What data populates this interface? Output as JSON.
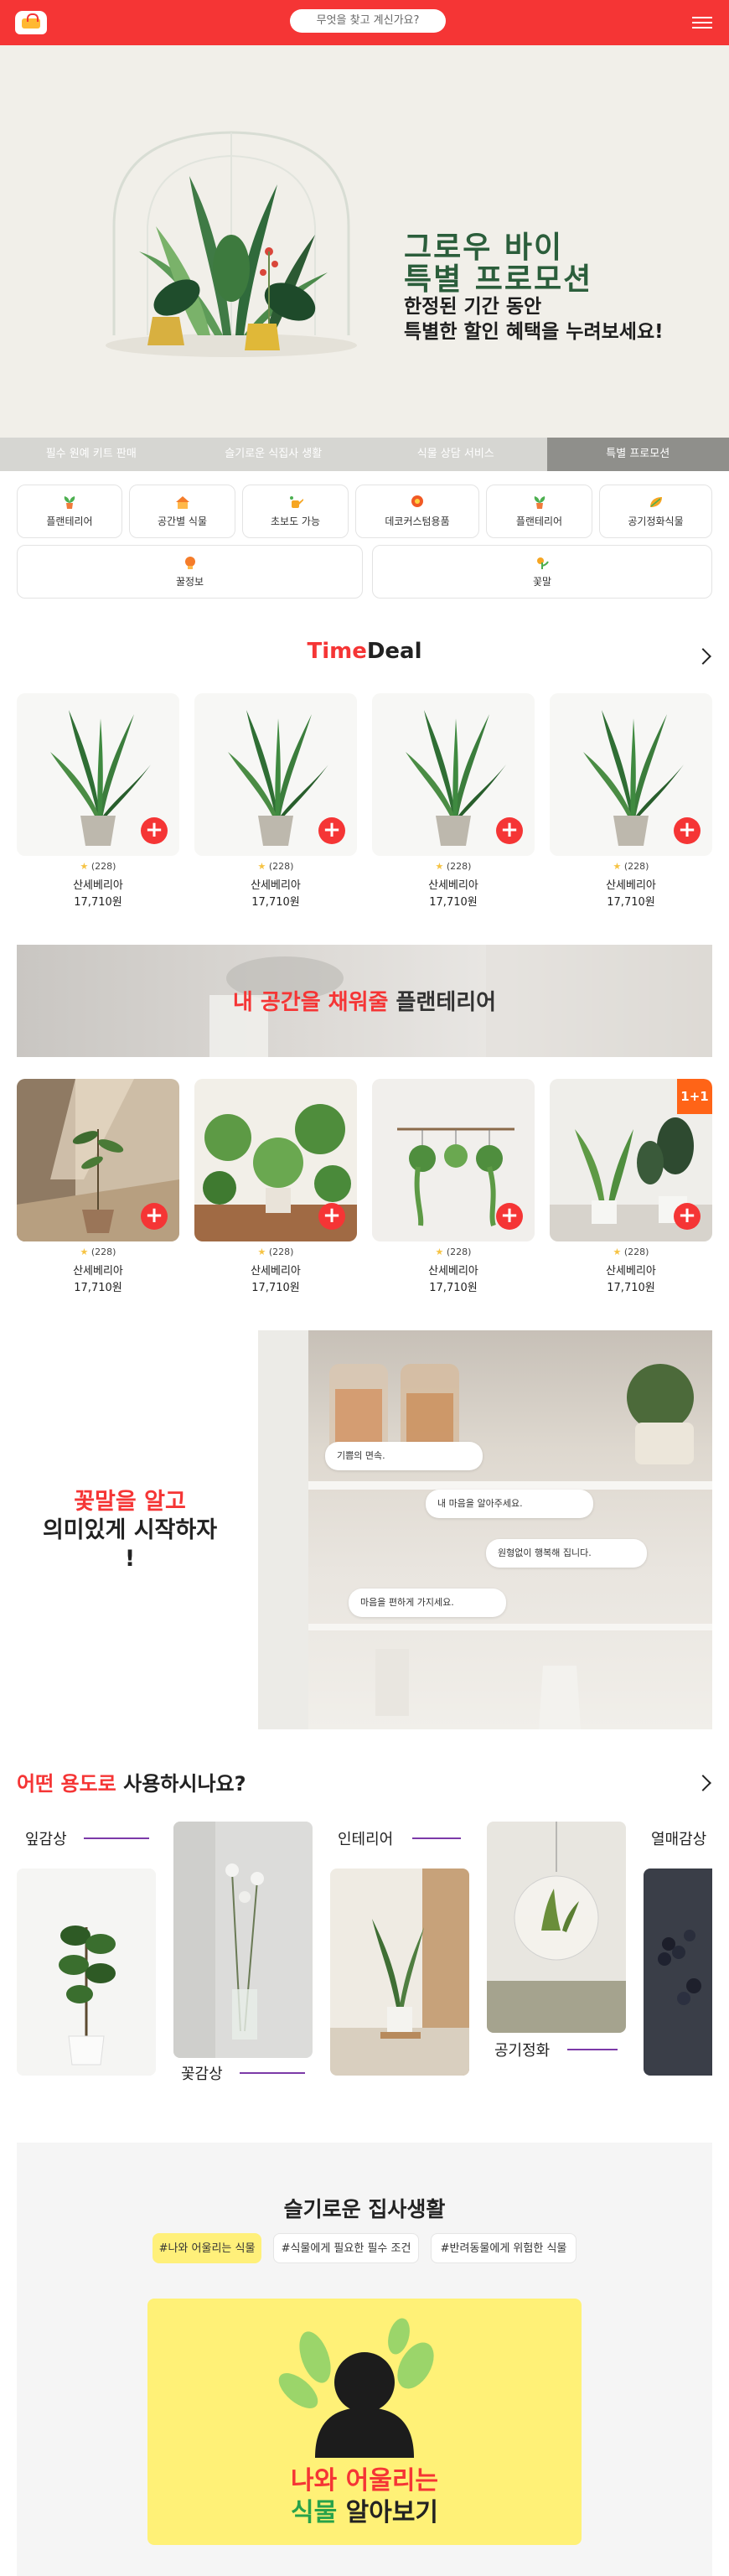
{
  "header": {
    "search_placeholder": "무엇을 찾고 계신가요?"
  },
  "hero": {
    "title_line1": "그로우 바이",
    "title_line2": "특별 프로모션",
    "sub_line1": "한정된 기간 동안",
    "sub_line2": "특별한 할인 혜택을 누려보세요!"
  },
  "tabs": [
    {
      "label": "필수 원예 키트 판매"
    },
    {
      "label": "슬기로운 식집사 생활"
    },
    {
      "label": "식물 상담 서비스"
    },
    {
      "label": "특별 프로모션"
    }
  ],
  "categories": [
    {
      "label": "플랜테리어",
      "icon": "plant-icon"
    },
    {
      "label": "공간별 식물",
      "icon": "house-icon"
    },
    {
      "label": "초보도 가능",
      "icon": "watering-can-icon"
    },
    {
      "label": "데코커스텀용품",
      "icon": "pot-icon"
    },
    {
      "label": "플랜테리어",
      "icon": "plant-icon"
    },
    {
      "label": "공기정화식물",
      "icon": "leaf-icon"
    },
    {
      "label": "꿀정보",
      "icon": "lightbulb-icon"
    },
    {
      "label": "꽃말",
      "icon": "flower-icon"
    }
  ],
  "timedeal": {
    "title_part1": "Time",
    "title_part2": "Deal",
    "products": [
      {
        "rating": "(228)",
        "name": "산세베리아",
        "price": "17,710원"
      },
      {
        "rating": "(228)",
        "name": "산세베리아",
        "price": "17,710원"
      },
      {
        "rating": "(228)",
        "name": "산세베리아",
        "price": "17,710원"
      },
      {
        "rating": "(228)",
        "name": "산세베리아",
        "price": "17,710원"
      }
    ]
  },
  "banner": {
    "highlight": "내 공간을 채워줄",
    "rest": "플랜테리어"
  },
  "planterior": {
    "products": [
      {
        "rating": "(228)",
        "name": "산세베리아",
        "price": "17,710원"
      },
      {
        "rating": "(228)",
        "name": "산세베리아",
        "price": "17,710원"
      },
      {
        "rating": "(228)",
        "name": "산세베리아",
        "price": "17,710원"
      },
      {
        "rating": "(228)",
        "name": "산세베리아",
        "price": "17,710원",
        "badge": "1+1"
      }
    ]
  },
  "flower_language": {
    "line1": "꽃말을 알고",
    "line2": "의미있게 시작하자",
    "line3": "!",
    "bubbles": [
      "기쁨의 면속.",
      "내 마음을 알아주세요.",
      "원형없이 행복해 집니다.",
      "마음을 편하게 가지세요."
    ]
  },
  "usage": {
    "title_highlight": "어떤 용도로",
    "title_rest": "사용하시나요?",
    "items": [
      "잎감상",
      "꽃감상",
      "인테리어",
      "공기정화",
      "열매감상"
    ]
  },
  "smart_life": {
    "title": "슬기로운 집사생활",
    "chips": [
      "#나와 어울리는 식물",
      "#식물에게 필요한 필수 조건",
      "#반려동물에게 위험한 식물"
    ],
    "card_line1": "나와 어울리는",
    "card_line2_a": "식물",
    "card_line2_b": "알아보기"
  },
  "colors": {
    "brand_red": "#f53535",
    "dark_green": "#2b5e3b",
    "usage_purple": "#7c3aa8",
    "yellow": "#fff177"
  }
}
